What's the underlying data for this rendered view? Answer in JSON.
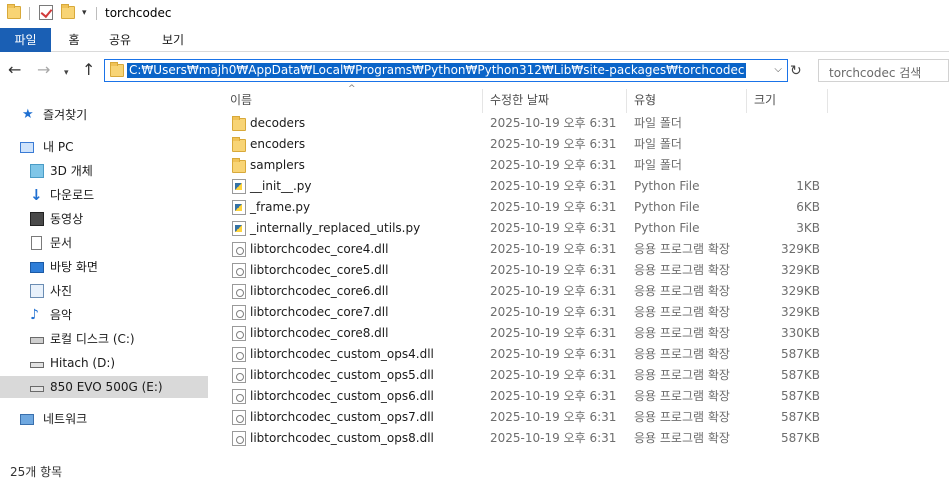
{
  "window": {
    "title": "torchcodec"
  },
  "ribbon": {
    "tabs": [
      "파일",
      "홈",
      "공유",
      "보기"
    ]
  },
  "address": {
    "path": "C:₩Users₩majh0₩AppData₩Local₩Programs₩Python₩Python312₩Lib₩site-packages₩torchcodec",
    "search_placeholder": "torchcodec 검색"
  },
  "nav_pane": {
    "items": [
      {
        "label": "즐겨찾기",
        "icon": "star-icon"
      },
      {
        "label": "내 PC",
        "icon": "computer-icon"
      },
      {
        "label": "3D 개체",
        "icon": "cube-icon"
      },
      {
        "label": "다운로드",
        "icon": "download-icon"
      },
      {
        "label": "동영상",
        "icon": "video-icon"
      },
      {
        "label": "문서",
        "icon": "document-icon"
      },
      {
        "label": "바탕 화면",
        "icon": "desktop-icon"
      },
      {
        "label": "사진",
        "icon": "picture-icon"
      },
      {
        "label": "음악",
        "icon": "music-icon"
      },
      {
        "label": "로컬 디스크 (C:)",
        "icon": "drive-icon"
      },
      {
        "label": "Hitach (D:)",
        "icon": "drive-icon"
      },
      {
        "label": "850 EVO 500G (E:)",
        "icon": "drive-icon",
        "selected": true
      },
      {
        "label": "네트워크",
        "icon": "network-icon"
      }
    ]
  },
  "columns": {
    "name": "이름",
    "date": "수정한 날짜",
    "type": "유형",
    "size": "크기"
  },
  "files": [
    {
      "name": "decoders",
      "date": "2025-10-19 오후 6:31",
      "type": "파일 폴더",
      "size": "",
      "icon": "folder-icon"
    },
    {
      "name": "encoders",
      "date": "2025-10-19 오후 6:31",
      "type": "파일 폴더",
      "size": "",
      "icon": "folder-icon"
    },
    {
      "name": "samplers",
      "date": "2025-10-19 오후 6:31",
      "type": "파일 폴더",
      "size": "",
      "icon": "folder-icon"
    },
    {
      "name": "__init__.py",
      "date": "2025-10-19 오후 6:31",
      "type": "Python File",
      "size": "1KB",
      "icon": "python-file-icon"
    },
    {
      "name": "_frame.py",
      "date": "2025-10-19 오후 6:31",
      "type": "Python File",
      "size": "6KB",
      "icon": "python-file-icon"
    },
    {
      "name": "_internally_replaced_utils.py",
      "date": "2025-10-19 오후 6:31",
      "type": "Python File",
      "size": "3KB",
      "icon": "python-file-icon"
    },
    {
      "name": "libtorchcodec_core4.dll",
      "date": "2025-10-19 오후 6:31",
      "type": "응용 프로그램 확장",
      "size": "329KB",
      "icon": "dll-file-icon"
    },
    {
      "name": "libtorchcodec_core5.dll",
      "date": "2025-10-19 오후 6:31",
      "type": "응용 프로그램 확장",
      "size": "329KB",
      "icon": "dll-file-icon"
    },
    {
      "name": "libtorchcodec_core6.dll",
      "date": "2025-10-19 오후 6:31",
      "type": "응용 프로그램 확장",
      "size": "329KB",
      "icon": "dll-file-icon"
    },
    {
      "name": "libtorchcodec_core7.dll",
      "date": "2025-10-19 오후 6:31",
      "type": "응용 프로그램 확장",
      "size": "329KB",
      "icon": "dll-file-icon"
    },
    {
      "name": "libtorchcodec_core8.dll",
      "date": "2025-10-19 오후 6:31",
      "type": "응용 프로그램 확장",
      "size": "330KB",
      "icon": "dll-file-icon"
    },
    {
      "name": "libtorchcodec_custom_ops4.dll",
      "date": "2025-10-19 오후 6:31",
      "type": "응용 프로그램 확장",
      "size": "587KB",
      "icon": "dll-file-icon"
    },
    {
      "name": "libtorchcodec_custom_ops5.dll",
      "date": "2025-10-19 오후 6:31",
      "type": "응용 프로그램 확장",
      "size": "587KB",
      "icon": "dll-file-icon"
    },
    {
      "name": "libtorchcodec_custom_ops6.dll",
      "date": "2025-10-19 오후 6:31",
      "type": "응용 프로그램 확장",
      "size": "587KB",
      "icon": "dll-file-icon"
    },
    {
      "name": "libtorchcodec_custom_ops7.dll",
      "date": "2025-10-19 오후 6:31",
      "type": "응용 프로그램 확장",
      "size": "587KB",
      "icon": "dll-file-icon"
    },
    {
      "name": "libtorchcodec_custom_ops8.dll",
      "date": "2025-10-19 오후 6:31",
      "type": "응용 프로그램 확장",
      "size": "587KB",
      "icon": "dll-file-icon"
    }
  ],
  "status": {
    "item_count": "25개 항목"
  },
  "colors": {
    "accent": "#1a5fb4",
    "selection": "#0a64c8",
    "folder": "#f8d475"
  }
}
